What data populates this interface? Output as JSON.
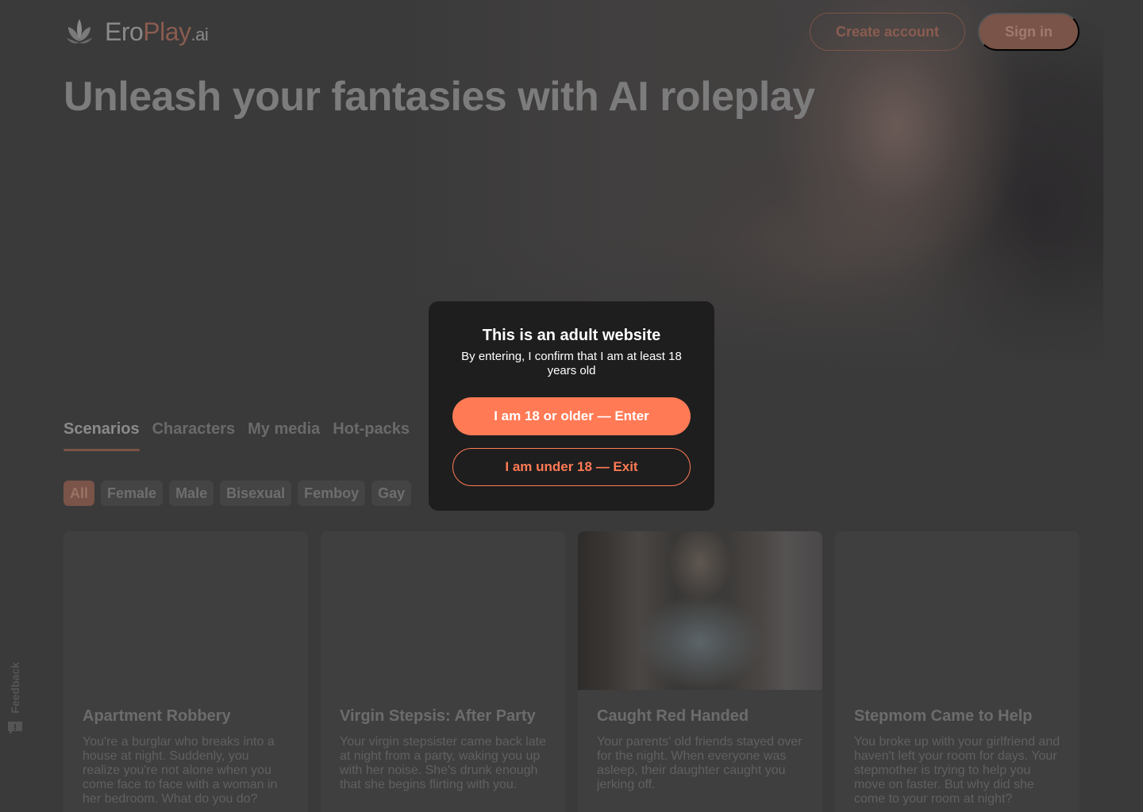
{
  "brand": {
    "logo_part1": "Ero",
    "logo_part2": "Play",
    "logo_part3": ".ai"
  },
  "header": {
    "create_account_label": "Create account",
    "sign_in_label": "Sign in"
  },
  "hero": {
    "headline": "Unleash your fantasies with AI roleplay"
  },
  "tabs": [
    {
      "label": "Scenarios",
      "active": true
    },
    {
      "label": "Characters",
      "active": false
    },
    {
      "label": "My media",
      "active": false
    },
    {
      "label": "Hot-packs",
      "active": false
    }
  ],
  "filters": [
    {
      "label": "All",
      "active": true
    },
    {
      "label": "Female",
      "active": false
    },
    {
      "label": "Male",
      "active": false
    },
    {
      "label": "Bisexual",
      "active": false
    },
    {
      "label": "Femboy",
      "active": false
    },
    {
      "label": "Gay",
      "active": false
    }
  ],
  "cards": [
    {
      "title": "Apartment Robbery",
      "description": "You're a burglar who breaks into a house at night. Suddenly, you realize you're not alone when you come face to face with a woman in her bedroom. What do you do?"
    },
    {
      "title": "Virgin Stepsis: After Party",
      "description": "Your virgin stepsister came back late at night from a party, waking you up with her noise. She's drunk enough that she begins flirting with you."
    },
    {
      "title": "Caught Red Handed",
      "description": "Your parents' old friends stayed over for the night. When everyone was asleep, their daughter caught you jerking off."
    },
    {
      "title": "Stepmom Came to Help",
      "description": "You broke up with your girlfriend and haven't left your room for days. Your stepmother is trying to help you move on faster. But why did she come to your room at night?"
    }
  ],
  "feedback": {
    "label": "Feedback"
  },
  "modal": {
    "title": "This is an adult website",
    "subtitle": "By entering, I confirm that I am at least 18 years old",
    "enter_label": "I am 18 or older — Enter",
    "exit_label": "I am under 18 — Exit"
  },
  "colors": {
    "accent": "#ff7a55",
    "modal_bg": "#1e1e1e",
    "page_bg": "#3a3a3a"
  }
}
